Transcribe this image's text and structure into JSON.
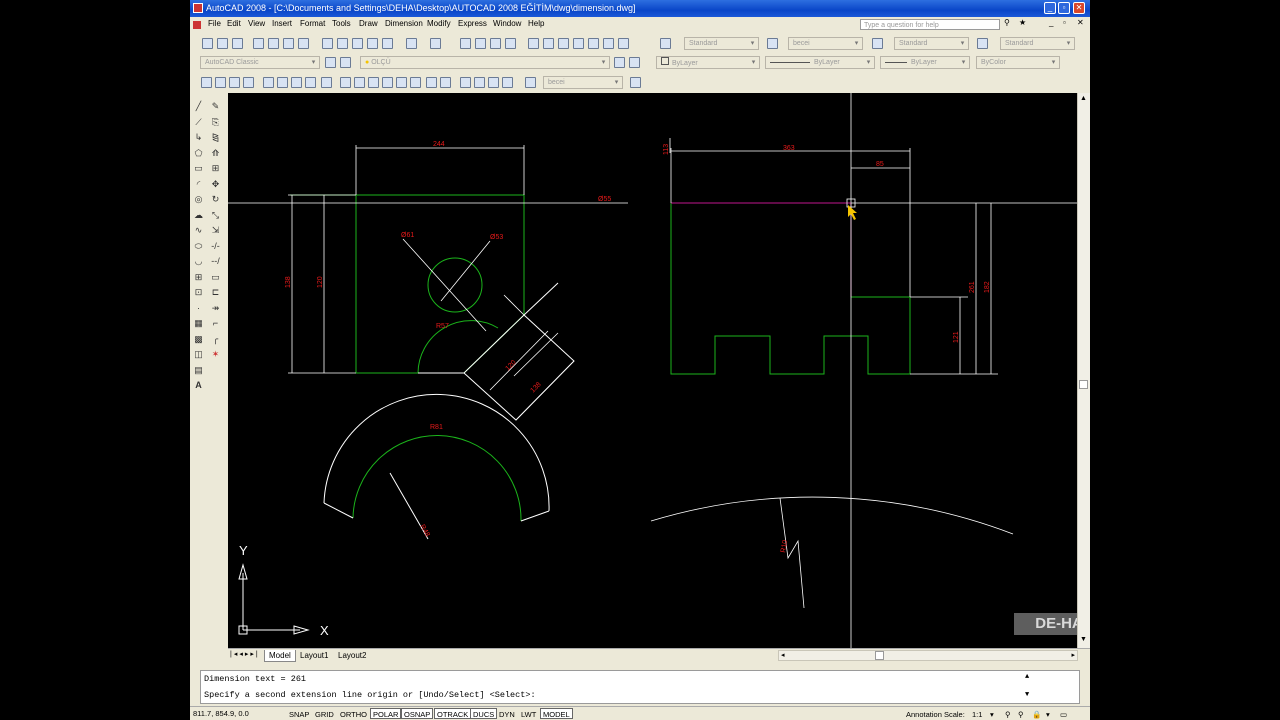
{
  "window": {
    "title": "AutoCAD 2008 - [C:\\Documents and Settings\\DEHA\\Desktop\\AUTOCAD 2008 EĞİTİM\\dwg\\dimension.dwg]",
    "minimize": "_",
    "restore": "▫",
    "close": "✕",
    "doc_minimize": "_",
    "doc_restore": "▫",
    "doc_close": "✕"
  },
  "menu": [
    "File",
    "Edit",
    "View",
    "Insert",
    "Format",
    "Tools",
    "Draw",
    "Dimension",
    "Modify",
    "Express",
    "Window",
    "Help"
  ],
  "help_search": {
    "placeholder": "Type a question for help"
  },
  "toolbar1": {
    "text_style": "Standard",
    "dim_style": "becei",
    "table_style": "Standard",
    "mleader_style": "Standard"
  },
  "toolbar2": {
    "workspace": "AutoCAD Classic",
    "layer": "OLÇÜ",
    "color": "ByLayer",
    "linetype": "ByLayer",
    "lineweight": "ByLayer",
    "plotstyle": "ByColor"
  },
  "toolbar3": {
    "dim_style": "becei"
  },
  "left_tools": {
    "text_tool": "A"
  },
  "drawing": {
    "dims": {
      "top_left": "244",
      "horiz_line": "Ø55",
      "left_outer": "138",
      "left_inner": "120",
      "circle_dia": "Ø61",
      "circle_dia2": "Ø53",
      "arc_label": "R57",
      "rot_small": "120",
      "rot_big": "138",
      "arc_big_top": "R81",
      "arc_big_radius": "R48",
      "right_top": "363",
      "right_small": "85",
      "right_left": "113",
      "right_v1": "261",
      "right_v2": "121",
      "right_v3": "182",
      "arc_bottom_radius": "R10"
    },
    "ucs": {
      "x": "X",
      "y": "Y"
    },
    "watermark": "DE-HA"
  },
  "tabs": [
    "Model",
    "Layout1",
    "Layout2"
  ],
  "command": {
    "line1": "Dimension text = 261",
    "line2": "Specify a second extension line origin or [Undo/Select] <Select>:"
  },
  "status": {
    "coords": "811.7, 854.9, 0.0",
    "buttons": [
      "SNAP",
      "GRID",
      "ORTHO",
      "POLAR",
      "OSNAP",
      "OTRACK",
      "DUCS",
      "DYN",
      "LWT",
      "MODEL"
    ],
    "annotation_scale_label": "Annotation Scale:",
    "annotation_scale": "1:1"
  },
  "colors": {
    "title_blue": "#0a46c8",
    "geometry_green": "#1bb31b",
    "dimension_white": "#ffffff",
    "dimension_text_red": "#e81a1a",
    "highlight_magenta": "#c0168e",
    "canvas": "#000000"
  }
}
